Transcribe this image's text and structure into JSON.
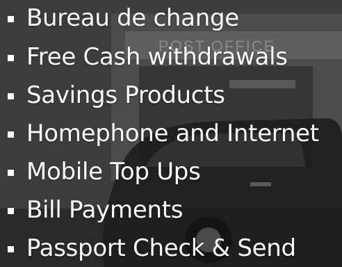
{
  "background": {
    "description_icon": "post-office-storefront-photo",
    "sign_text": "POST OFFICE",
    "tint": "#3a3a3a"
  },
  "services": [
    {
      "label": "Bureau de change"
    },
    {
      "label": "Free Cash withdrawals"
    },
    {
      "label": "Savings Products"
    },
    {
      "label": "Homephone and Internet"
    },
    {
      "label": "Mobile Top Ups"
    },
    {
      "label": "Bill Payments"
    },
    {
      "label": "Passport Check & Send"
    }
  ],
  "colors": {
    "text": "#ffffff",
    "bullet": "#ffffff"
  }
}
